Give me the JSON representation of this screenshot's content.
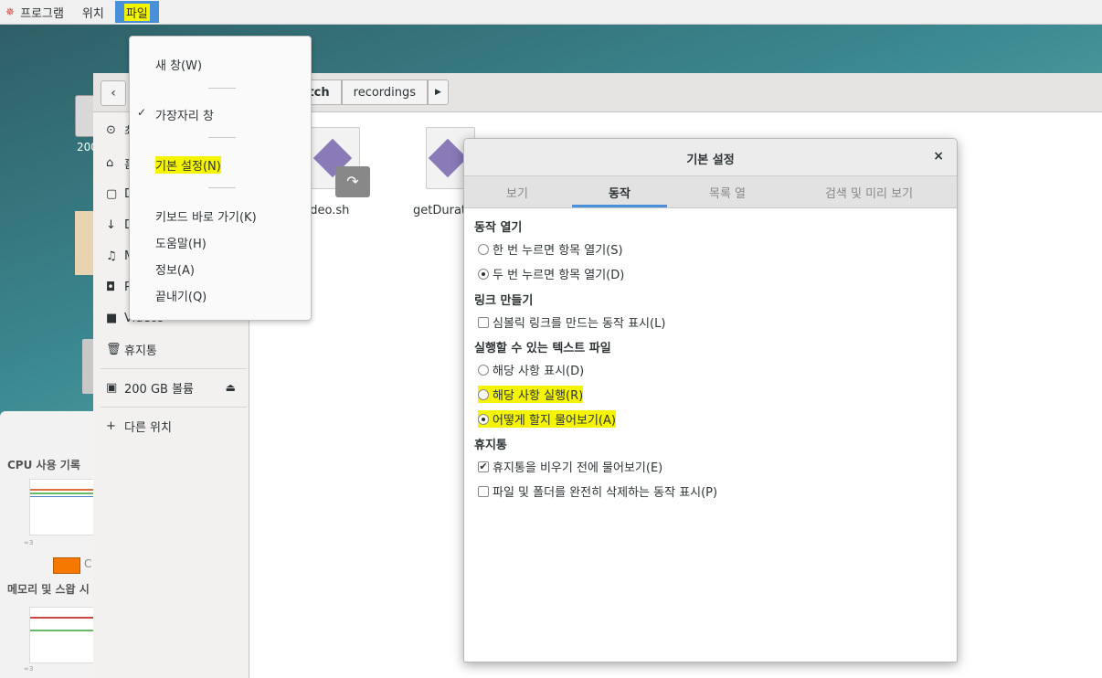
{
  "topbar": {
    "apps_label": "프로그램",
    "places_label": "위치",
    "files_label": "파일"
  },
  "desktop": {
    "drive_label": "200"
  },
  "sysmon": {
    "cpu_title": "CPU 사용 기록",
    "mem_title": "메모리 및 스왑 시",
    "axis1": "∞3",
    "axis2": "∞3",
    "cpu_legend": "C"
  },
  "files": {
    "path": [
      {
        "label": "itch"
      },
      {
        "label": "recordings"
      }
    ],
    "sidebar": [
      {
        "icon": "recent-icon",
        "glyph": "⊙",
        "label": "최"
      },
      {
        "icon": "home-icon",
        "glyph": "⌂",
        "label": "홈"
      },
      {
        "icon": "documents-icon",
        "glyph": "▢",
        "label": "D"
      },
      {
        "icon": "downloads-icon",
        "glyph": "↓",
        "label": "D"
      },
      {
        "icon": "music-icon",
        "glyph": "♫",
        "label": "M"
      },
      {
        "icon": "pictures-icon",
        "glyph": "◘",
        "label": "P"
      },
      {
        "icon": "videos-icon",
        "glyph": "■",
        "label": "Videos"
      },
      {
        "icon": "trash-icon",
        "glyph": "🗑",
        "label": "휴지통"
      },
      {
        "icon": "drive-icon",
        "glyph": "▣",
        "label": "200 GB 볼륨"
      },
      {
        "icon": "plus-icon",
        "glyph": "+",
        "label": "다른 위치"
      }
    ],
    "file1_name": "Video.sh",
    "file2_name": "getDurati"
  },
  "appmenu": {
    "new_window": "새 창(W)",
    "sidebar": "가장자리 창",
    "preferences": "기본 설정(N)",
    "shortcuts": "키보드 바로 가기(K)",
    "help": "도움말(H)",
    "about": "정보(A)",
    "quit": "끝내기(Q)"
  },
  "prefs": {
    "title": "기본 설정",
    "close": "×",
    "tabs": [
      "보기",
      "동작",
      "목록 열",
      "검색 및 미리 보기"
    ],
    "sections": {
      "open": "동작 열기",
      "links": "링크 만들기",
      "exec": "실행할 수 있는 텍스트 파일",
      "trash": "휴지통"
    },
    "options": {
      "single_click": "한 번 누르면 항목 열기(S)",
      "double_click": "두 번 누르면 항목 열기(D)",
      "symlink": "심볼릭 링크를 만드는 동작 표시(L)",
      "display": "해당 사항 표시(D)",
      "run": "해당 사항 실행(R)",
      "ask": "어떻게 할지 물어보기(A)",
      "confirm_trash": "휴지통을 비우기 전에 물어보기(E)",
      "delete_perm": "파일 및 폴더를 완전히 삭제하는 동작 표시(P)"
    }
  }
}
